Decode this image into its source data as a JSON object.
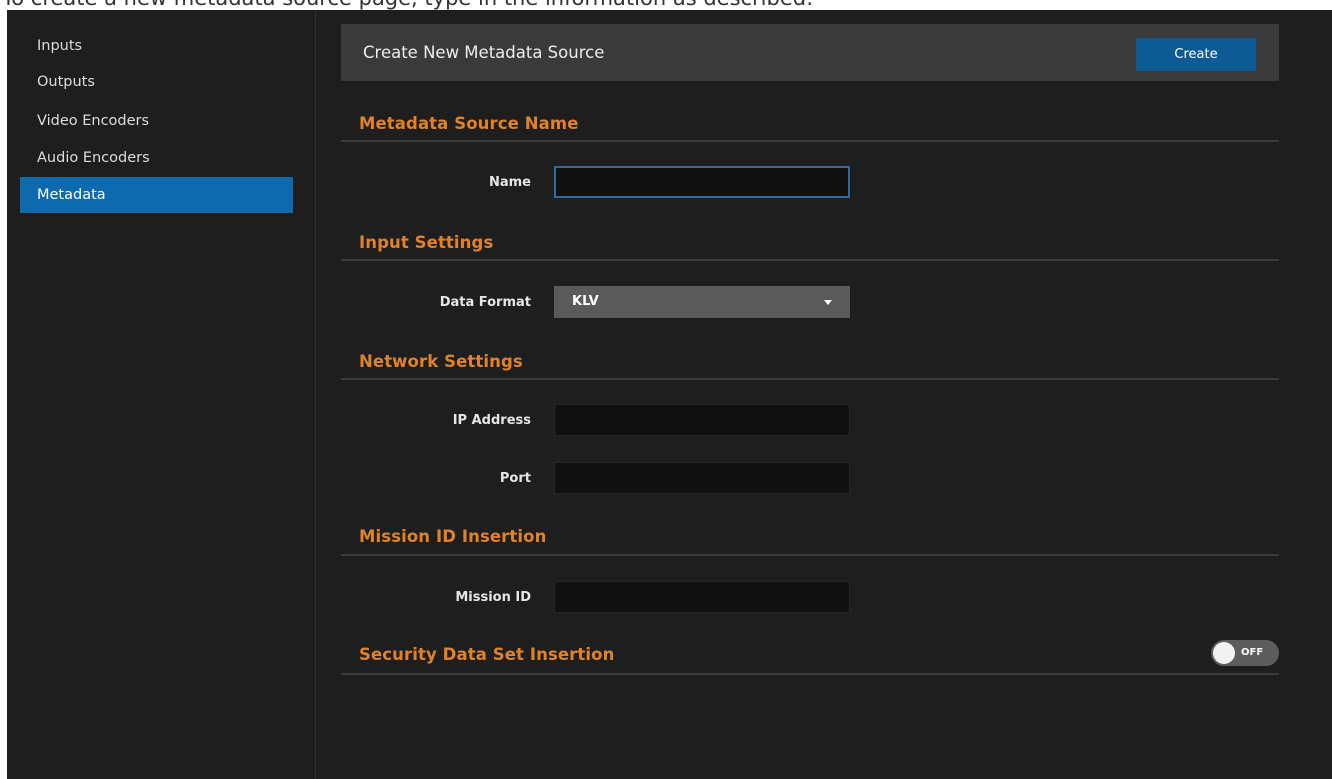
{
  "caption": "To create a new metadata source page, type in the information as described:",
  "sidebar": {
    "items": [
      {
        "label": "Inputs",
        "active": false
      },
      {
        "label": "Outputs",
        "active": false
      },
      {
        "label": "Video Encoders",
        "active": false
      },
      {
        "label": "Audio Encoders",
        "active": false
      },
      {
        "label": "Metadata",
        "active": true
      }
    ]
  },
  "header": {
    "title": "Create New Metadata Source",
    "create_label": "Create"
  },
  "sections": {
    "source_name": "Metadata Source Name",
    "input_settings": "Input Settings",
    "network_settings": "Network Settings",
    "mission_id": "Mission ID Insertion",
    "security": "Security Data Set Insertion"
  },
  "fields": {
    "name": {
      "label": "Name",
      "value": ""
    },
    "data_format": {
      "label": "Data Format",
      "value": "KLV"
    },
    "ip_address": {
      "label": "IP Address",
      "value": ""
    },
    "port": {
      "label": "Port",
      "value": ""
    },
    "mission_id": {
      "label": "Mission ID",
      "value": ""
    }
  },
  "security_toggle": {
    "state_label": "OFF",
    "on": false
  },
  "colors": {
    "accent_blue": "#0e6aad",
    "section_orange": "#e0822a",
    "background": "#1e1e1e"
  }
}
